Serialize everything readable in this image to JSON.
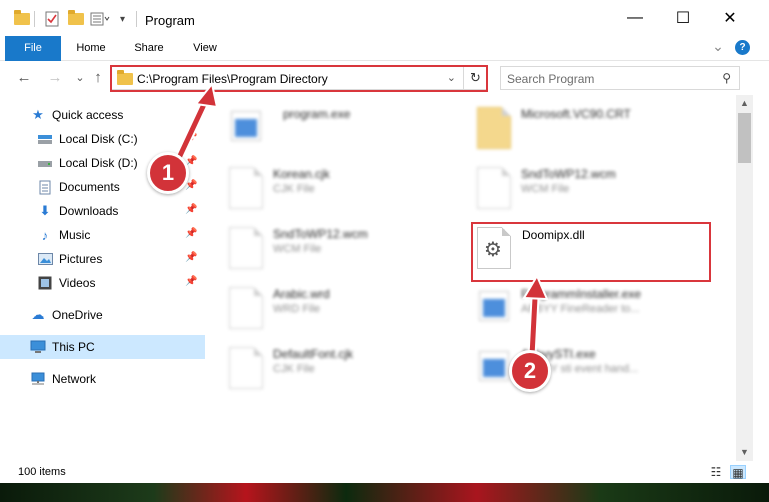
{
  "window": {
    "title": "Program",
    "minimize_glyph": "—",
    "maximize_glyph": "☐",
    "close_glyph": "✕"
  },
  "quick_access_toolbar": {
    "icons": [
      "folder-icon",
      "properties-icon",
      "new-folder-icon",
      "customize-icon"
    ]
  },
  "ribbon": {
    "tabs": [
      {
        "label": "File"
      },
      {
        "label": "Home"
      },
      {
        "label": "Share"
      },
      {
        "label": "View"
      }
    ],
    "collapse_glyph": "⌄",
    "help_glyph": "?"
  },
  "navigation": {
    "back_glyph": "←",
    "forward_glyph": "→",
    "recent_glyph": "⌄",
    "up_glyph": "↑",
    "address": "C:\\Program Files\\Program Directory",
    "address_dropdown_glyph": "⌄",
    "refresh_glyph": "↻",
    "search_placeholder": "Search Program",
    "search_glyph": "⚲"
  },
  "sidebar": {
    "items": [
      {
        "label": "Quick access",
        "icon": "star-icon",
        "pinned": false
      },
      {
        "label": "Local Disk (C:)",
        "icon": "drive-icon",
        "pinned": true
      },
      {
        "label": "Local Disk (D:)",
        "icon": "drive-icon",
        "pinned": true
      },
      {
        "label": "Documents",
        "icon": "document-icon",
        "pinned": true
      },
      {
        "label": "Downloads",
        "icon": "download-icon",
        "pinned": true
      },
      {
        "label": "Music",
        "icon": "music-icon",
        "pinned": true
      },
      {
        "label": "Pictures",
        "icon": "picture-icon",
        "pinned": true
      },
      {
        "label": "Videos",
        "icon": "video-icon",
        "pinned": true
      },
      {
        "label": "OneDrive",
        "icon": "cloud-icon",
        "pinned": false
      },
      {
        "label": "This PC",
        "icon": "computer-icon",
        "pinned": false,
        "selected": true
      },
      {
        "label": "Network",
        "icon": "network-icon",
        "pinned": false
      }
    ]
  },
  "files": [
    {
      "name": "program.exe",
      "type": "",
      "icon": "exe-icon",
      "blurred": true
    },
    {
      "name": "Microsoft.VC90.CRT",
      "type": "",
      "icon": "folder-icon",
      "blurred": true
    },
    {
      "name": "Korean.cjk",
      "type": "CJK File",
      "icon": "file-icon",
      "blurred": true
    },
    {
      "name": "SndToWP12.wcm",
      "type": "WCM File",
      "icon": "file-icon",
      "blurred": true
    },
    {
      "name": "SndToWP12.wcm",
      "type": "WCM File",
      "icon": "file-icon",
      "blurred": true
    },
    {
      "name": "Doomipx.dll",
      "type": "",
      "icon": "gear-file-icon",
      "blurred": false,
      "highlighted": true
    },
    {
      "name": "Arabic.wrd",
      "type": "WRD File",
      "icon": "file-icon",
      "blurred": true
    },
    {
      "name": "ProgrammInstaller.exe",
      "type": "ABBYY FineReader to...",
      "icon": "exe-icon",
      "blurred": true
    },
    {
      "name": "DefaultFont.cjk",
      "type": "CJK File",
      "icon": "file-icon",
      "blurred": true
    },
    {
      "name": "AbbyySTI.exe",
      "type": "ABBYY sti event hand...",
      "icon": "exe-icon",
      "blurred": true
    }
  ],
  "scrollbar": {
    "up_glyph": "▲",
    "down_glyph": "▼"
  },
  "status": {
    "item_count": "100 items",
    "details_view_glyph": "☷",
    "large_icons_view_glyph": "▦"
  },
  "callouts": [
    {
      "number": "1"
    },
    {
      "number": "2"
    }
  ],
  "colors": {
    "accent": "#1979ca",
    "highlight_red": "#d9363c",
    "callout_red": "#d23339",
    "selection": "#cce8ff"
  }
}
